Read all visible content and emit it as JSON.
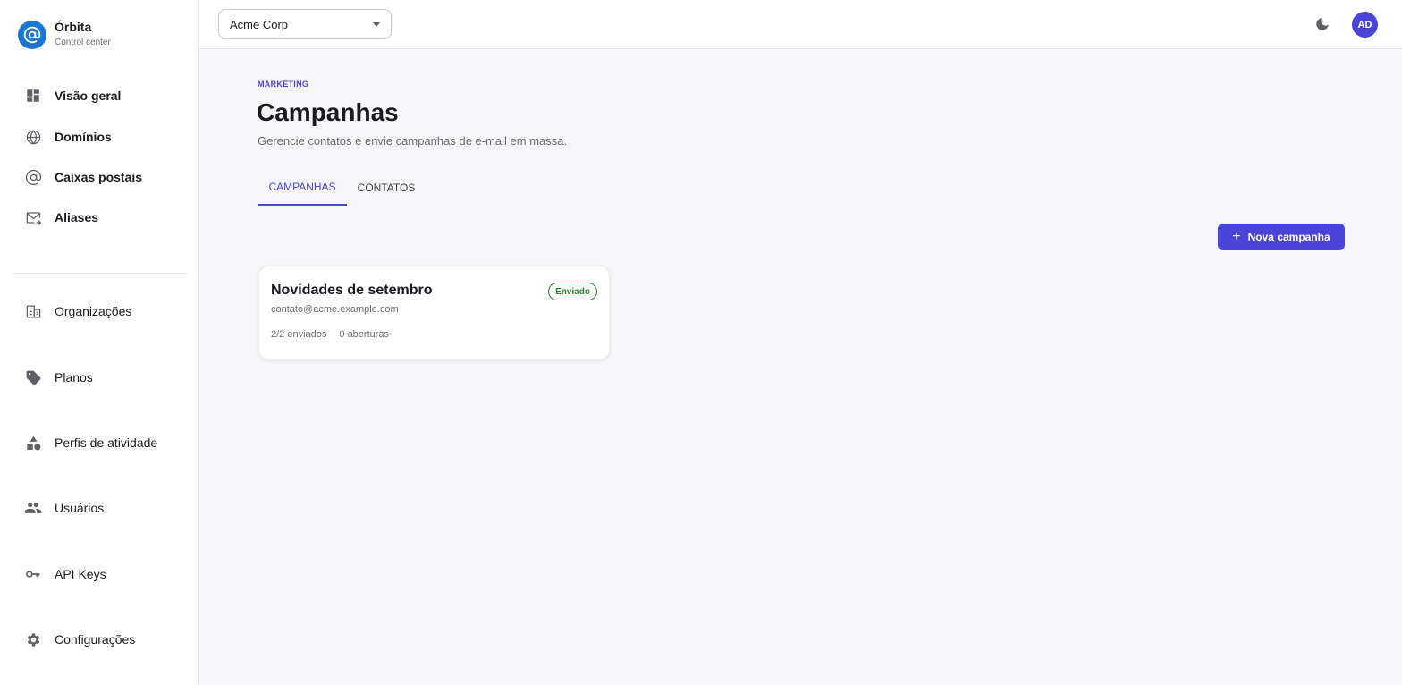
{
  "brand": {
    "name": "Órbita",
    "subtitle": "Control center",
    "logo_icon": "at-sign-icon",
    "logo_color": "#1976d2"
  },
  "sidebar": {
    "primary": [
      {
        "label": "Visão geral",
        "icon": "dashboard-icon"
      },
      {
        "label": "Domínios",
        "icon": "globe-icon"
      },
      {
        "label": "Caixas postais",
        "icon": "at-sign-icon"
      },
      {
        "label": "Aliases",
        "icon": "mail-forward-icon"
      }
    ],
    "secondary": [
      {
        "label": "Organizações",
        "icon": "building-icon"
      },
      {
        "label": "Planos",
        "icon": "tag-icon"
      },
      {
        "label": "Perfis de atividade",
        "icon": "shapes-icon"
      },
      {
        "label": "Usuários",
        "icon": "people-icon"
      },
      {
        "label": "API Keys",
        "icon": "key-icon"
      },
      {
        "label": "Configurações",
        "icon": "gear-icon"
      }
    ]
  },
  "topbar": {
    "org_selected": "Acme Corp",
    "avatar_initials": "AD",
    "theme_icon": "moon-icon"
  },
  "page": {
    "eyebrow": "MARKETING",
    "title": "Campanhas",
    "subtitle": "Gerencie contatos e envie campanhas de e-mail em massa."
  },
  "tabs": [
    {
      "label": "CAMPANHAS",
      "active": true
    },
    {
      "label": "CONTATOS",
      "active": false
    }
  ],
  "actions": {
    "new_campaign": "Nova campanha"
  },
  "campaigns": [
    {
      "title": "Novidades de setembro",
      "status": "Enviado",
      "sender": "contato@acme.example.com",
      "sent": "2/2 enviados",
      "opens": "0 aberturas"
    }
  ],
  "colors": {
    "accent": "#4b44d8",
    "success": "#2e7d32",
    "brand": "#1976d2"
  }
}
